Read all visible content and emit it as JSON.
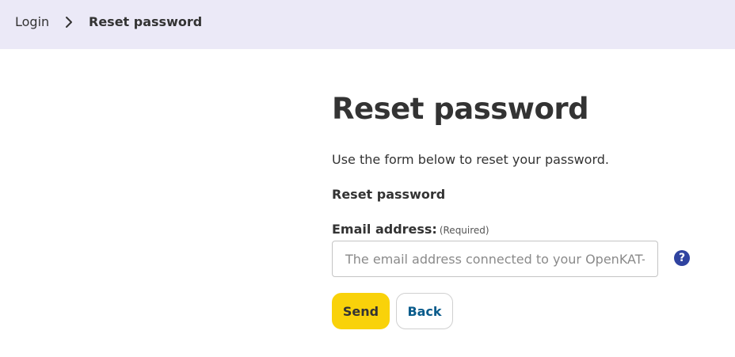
{
  "breadcrumb": {
    "items": [
      {
        "label": "Login"
      },
      {
        "label": "Reset password"
      }
    ]
  },
  "page": {
    "title": "Reset password",
    "intro": "Use the form below to reset your password."
  },
  "form": {
    "heading": "Reset password",
    "email": {
      "label": "Email address:",
      "required_text": "(Required)",
      "value": "",
      "placeholder": "The email address connected to your OpenKAT-account"
    },
    "help_icon": "question-mark-icon",
    "send_label": "Send",
    "back_label": "Back"
  },
  "colors": {
    "breadcrumb_bg": "#ebe9f7",
    "primary_button": "#f9d20a",
    "link": "#0a5c8c",
    "help_icon": "#2f43a0"
  }
}
